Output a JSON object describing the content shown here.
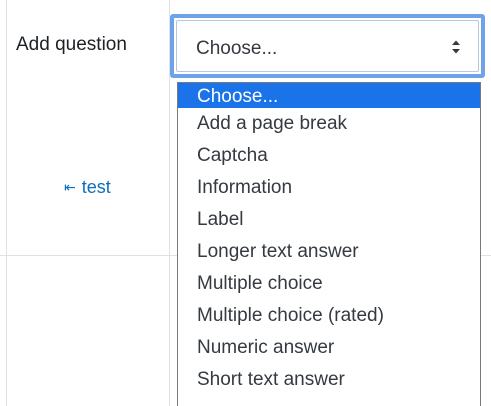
{
  "form": {
    "add_question_label": "Add question"
  },
  "select": {
    "value": "Choose...",
    "chevron_icon": "updown-chevrons-icon"
  },
  "dropdown": {
    "options": [
      {
        "label": "Choose...",
        "selected": true
      },
      {
        "label": "Add a page break",
        "selected": false
      },
      {
        "label": "Captcha",
        "selected": false
      },
      {
        "label": "Information",
        "selected": false
      },
      {
        "label": "Label",
        "selected": false
      },
      {
        "label": "Longer text answer",
        "selected": false
      },
      {
        "label": "Multiple choice",
        "selected": false
      },
      {
        "label": "Multiple choice (rated)",
        "selected": false
      },
      {
        "label": "Numeric answer",
        "selected": false
      },
      {
        "label": "Short text answer",
        "selected": false
      }
    ]
  },
  "nav": {
    "back_arrow_icon": "arrow-to-left-icon",
    "back_link_label": "test"
  },
  "colors": {
    "selected_option_bg": "#1a73e8",
    "focus_ring": "#6ea4e7",
    "link": "#0f6cbf"
  }
}
